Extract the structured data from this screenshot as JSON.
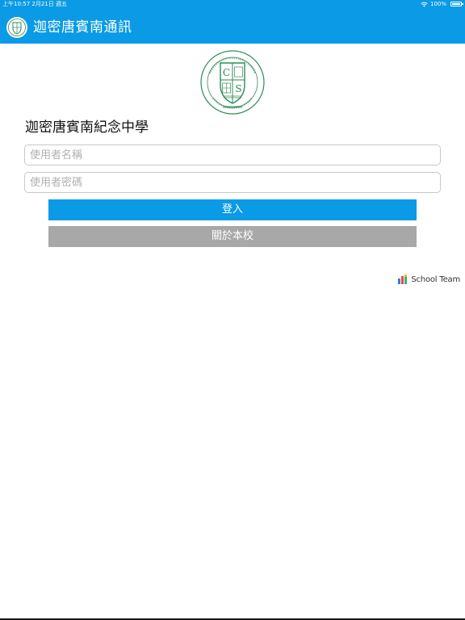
{
  "status_bar": {
    "left": "上午10:57  2月21日 週五",
    "battery": "100%"
  },
  "nav": {
    "title": "迦密唐賓南通訊",
    "icon": "school-crest-icon"
  },
  "login": {
    "school_name": "迦密唐賓南紀念中學",
    "username_placeholder": "使用者名稱",
    "password_placeholder": "使用者密碼",
    "login_label": "登入",
    "about_label": "關於本校"
  },
  "footer": {
    "brand": "School Team"
  },
  "colors": {
    "accent": "#0a9ae6",
    "secondary_button": "#a8a8a8",
    "crest_green": "#2e8b57"
  }
}
